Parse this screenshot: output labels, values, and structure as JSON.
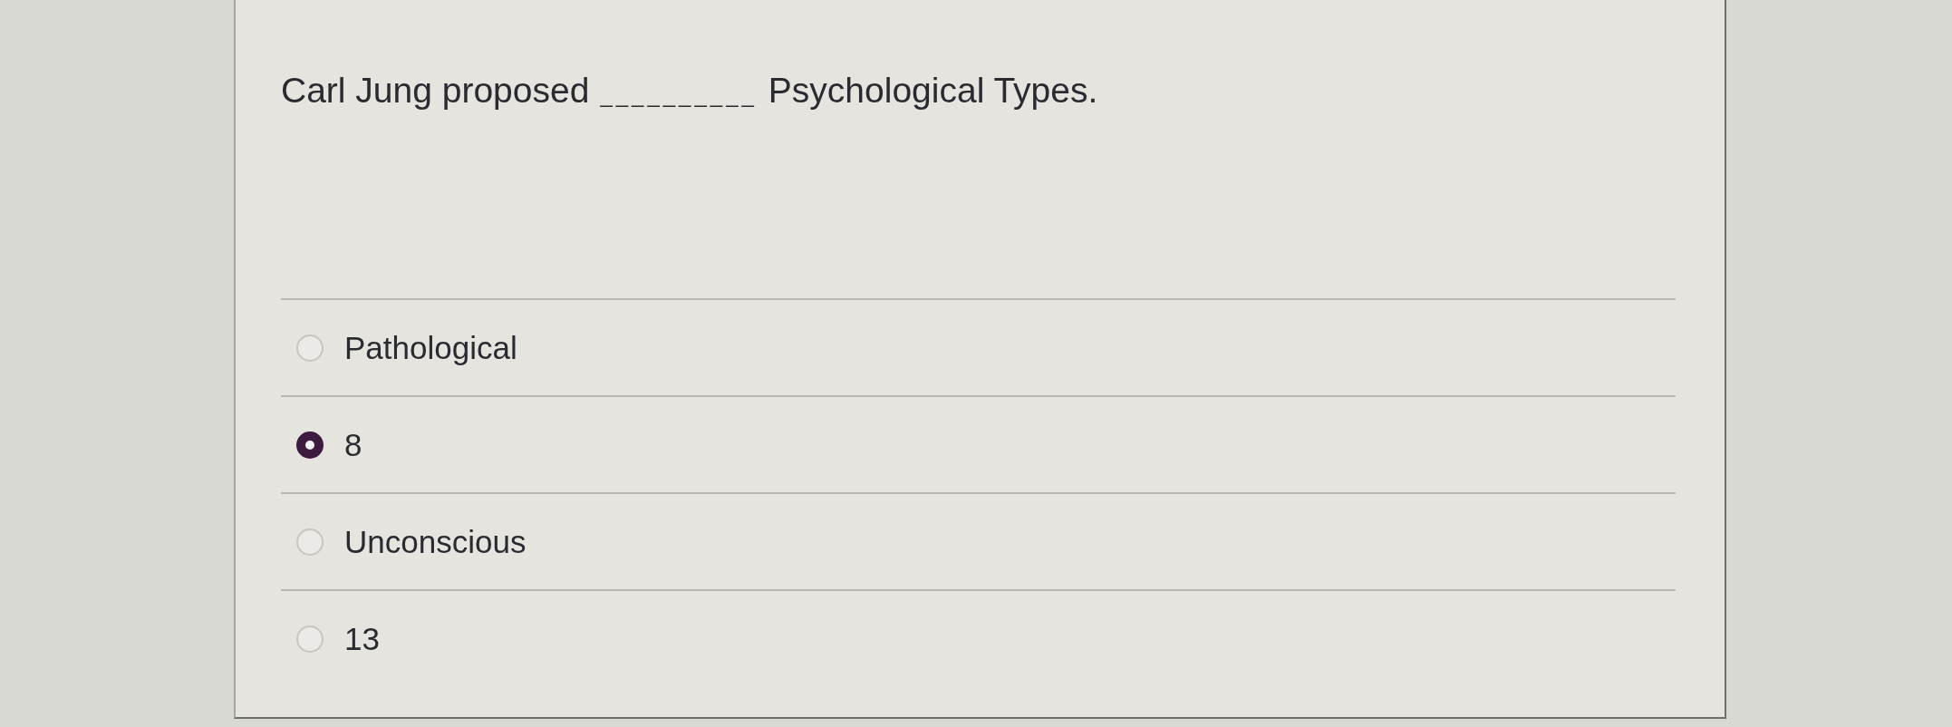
{
  "question": {
    "start": "Carl Jung proposed",
    "blank": "__________",
    "end": "Psychological Types."
  },
  "options": [
    {
      "label": "Pathological",
      "selected": false
    },
    {
      "label": "8",
      "selected": true
    },
    {
      "label": "Unconscious",
      "selected": false
    },
    {
      "label": "13",
      "selected": false
    }
  ]
}
